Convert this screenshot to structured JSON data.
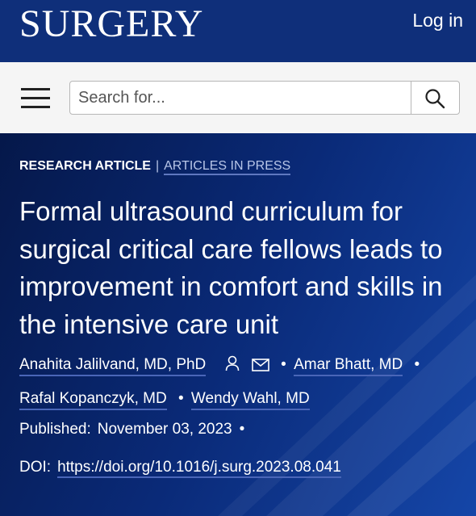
{
  "header": {
    "logo": "SURGERY",
    "login": "Log in"
  },
  "search": {
    "placeholder": "Search for..."
  },
  "article": {
    "type": "RESEARCH ARTICLE",
    "separator": "|",
    "status": "ARTICLES IN PRESS",
    "title": "Formal ultrasound curriculum for surgical critical care fellows leads to improvement in comfort and skills in the intensive care unit",
    "authors": [
      {
        "name": "Anahita Jalilvand, MD, PhD"
      },
      {
        "name": "Amar Bhatt, MD"
      },
      {
        "name": "Rafal Kopanczyk, MD"
      },
      {
        "name": "Wendy Wahl, MD"
      }
    ],
    "bullet": "•",
    "published_label": "Published:",
    "published_date": "November 03, 2023",
    "doi_label": "DOI:",
    "doi": "https://doi.org/10.1016/j.surg.2023.08.041"
  },
  "colors": {
    "header_bg": "#0f2f7a",
    "hero_bg_dark": "#05184a",
    "hero_bg_light": "#1546a8",
    "link_underline": "#4a66b8"
  },
  "icons": [
    "menu-icon",
    "search-icon",
    "person-icon",
    "envelope-icon"
  ]
}
